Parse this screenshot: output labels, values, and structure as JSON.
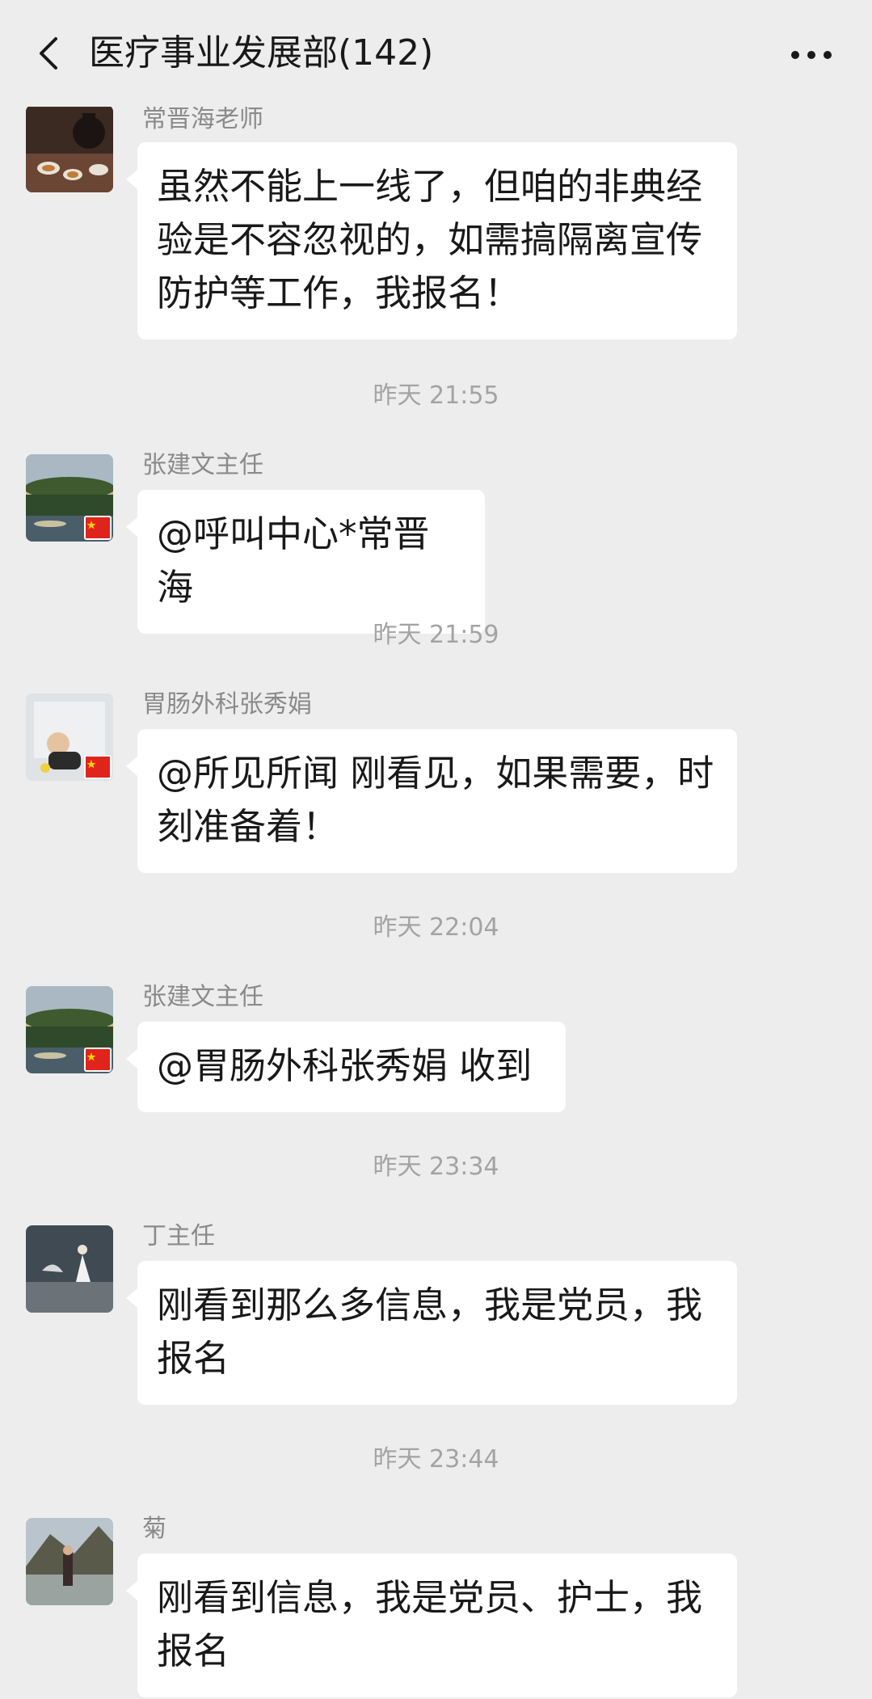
{
  "header": {
    "title": "医疗事业发展部(142)",
    "back_icon": "chevron-left-icon",
    "more_icon": "more-dots-icon"
  },
  "messages": [
    {
      "sender": "常晋海老师",
      "text": "虽然不能上一线了，但咱的非典经验是不容忽视的，如需搞隔离宣传防护等工作，我报名！"
    },
    {
      "timestamp": "昨天 21:55",
      "sender": "张建文主任",
      "text": "@呼叫中心*常晋海"
    },
    {
      "timestamp": "昨天 21:59",
      "sender": "胃肠外科张秀娟",
      "text": "@所见所闻  刚看见，如果需要，时刻准备着！"
    },
    {
      "timestamp": "昨天 22:04",
      "sender": "张建文主任",
      "text": "@胃肠外科张秀娟  收到"
    },
    {
      "timestamp": "昨天 23:34",
      "sender": "丁主任",
      "text": "刚看到那么多信息，我是党员，我报名"
    },
    {
      "timestamp": "昨天 23:44",
      "sender": "菊",
      "text": "刚看到信息，我是党员、护士，我报名"
    }
  ],
  "colors": {
    "background": "#ededed",
    "bubble": "#ffffff",
    "timestamp": "#a3a3a3",
    "sender": "#8a8a8a",
    "flag": "#e0241b"
  }
}
